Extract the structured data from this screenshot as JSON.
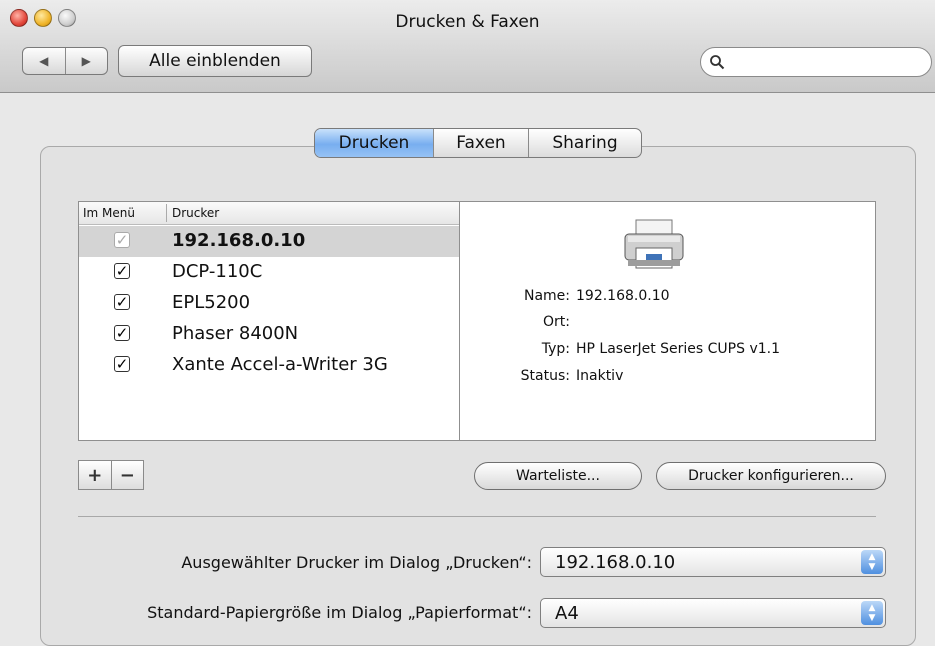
{
  "window": {
    "title": "Drucken & Faxen"
  },
  "toolbar": {
    "back": "◀",
    "forward": "▶",
    "show_all": "Alle einblenden",
    "search_placeholder": ""
  },
  "tabs": [
    {
      "label": "Drucken",
      "selected": true
    },
    {
      "label": "Faxen"
    },
    {
      "label": "Sharing"
    }
  ],
  "list": {
    "col_menu": "Im Menü",
    "col_printer": "Drucker",
    "rows": [
      {
        "name": "192.168.0.10",
        "checked": "✓",
        "selected": true
      },
      {
        "name": "DCP-110C",
        "checked": "✓"
      },
      {
        "name": "EPL5200",
        "checked": "✓"
      },
      {
        "name": "Phaser 8400N",
        "checked": "✓"
      },
      {
        "name": "Xante Accel-a-Writer 3G",
        "checked": "✓"
      }
    ]
  },
  "details": {
    "name_label": "Name:",
    "name_value": "192.168.0.10",
    "location_label": "Ort:",
    "location_value": "",
    "type_label": "Typ:",
    "type_value": "HP LaserJet Series CUPS v1.1",
    "status_label": "Status:",
    "status_value": "Inaktiv"
  },
  "buttons": {
    "add": "+",
    "remove": "−",
    "queue": "Warteliste...",
    "configure": "Drucker konfigurieren..."
  },
  "footer": {
    "selected_printer_label": "Ausgewählter Drucker im Dialog „Drucken“:",
    "selected_printer_value": "192.168.0.10",
    "paper_label": "Standard-Papiergröße im Dialog „Papierformat“:",
    "paper_value": "A4"
  },
  "icons": {
    "popup_arrows_up": "▲",
    "popup_arrows_down": "▼",
    "search": "⚲"
  },
  "colors": {
    "accent": "#78aef0"
  }
}
